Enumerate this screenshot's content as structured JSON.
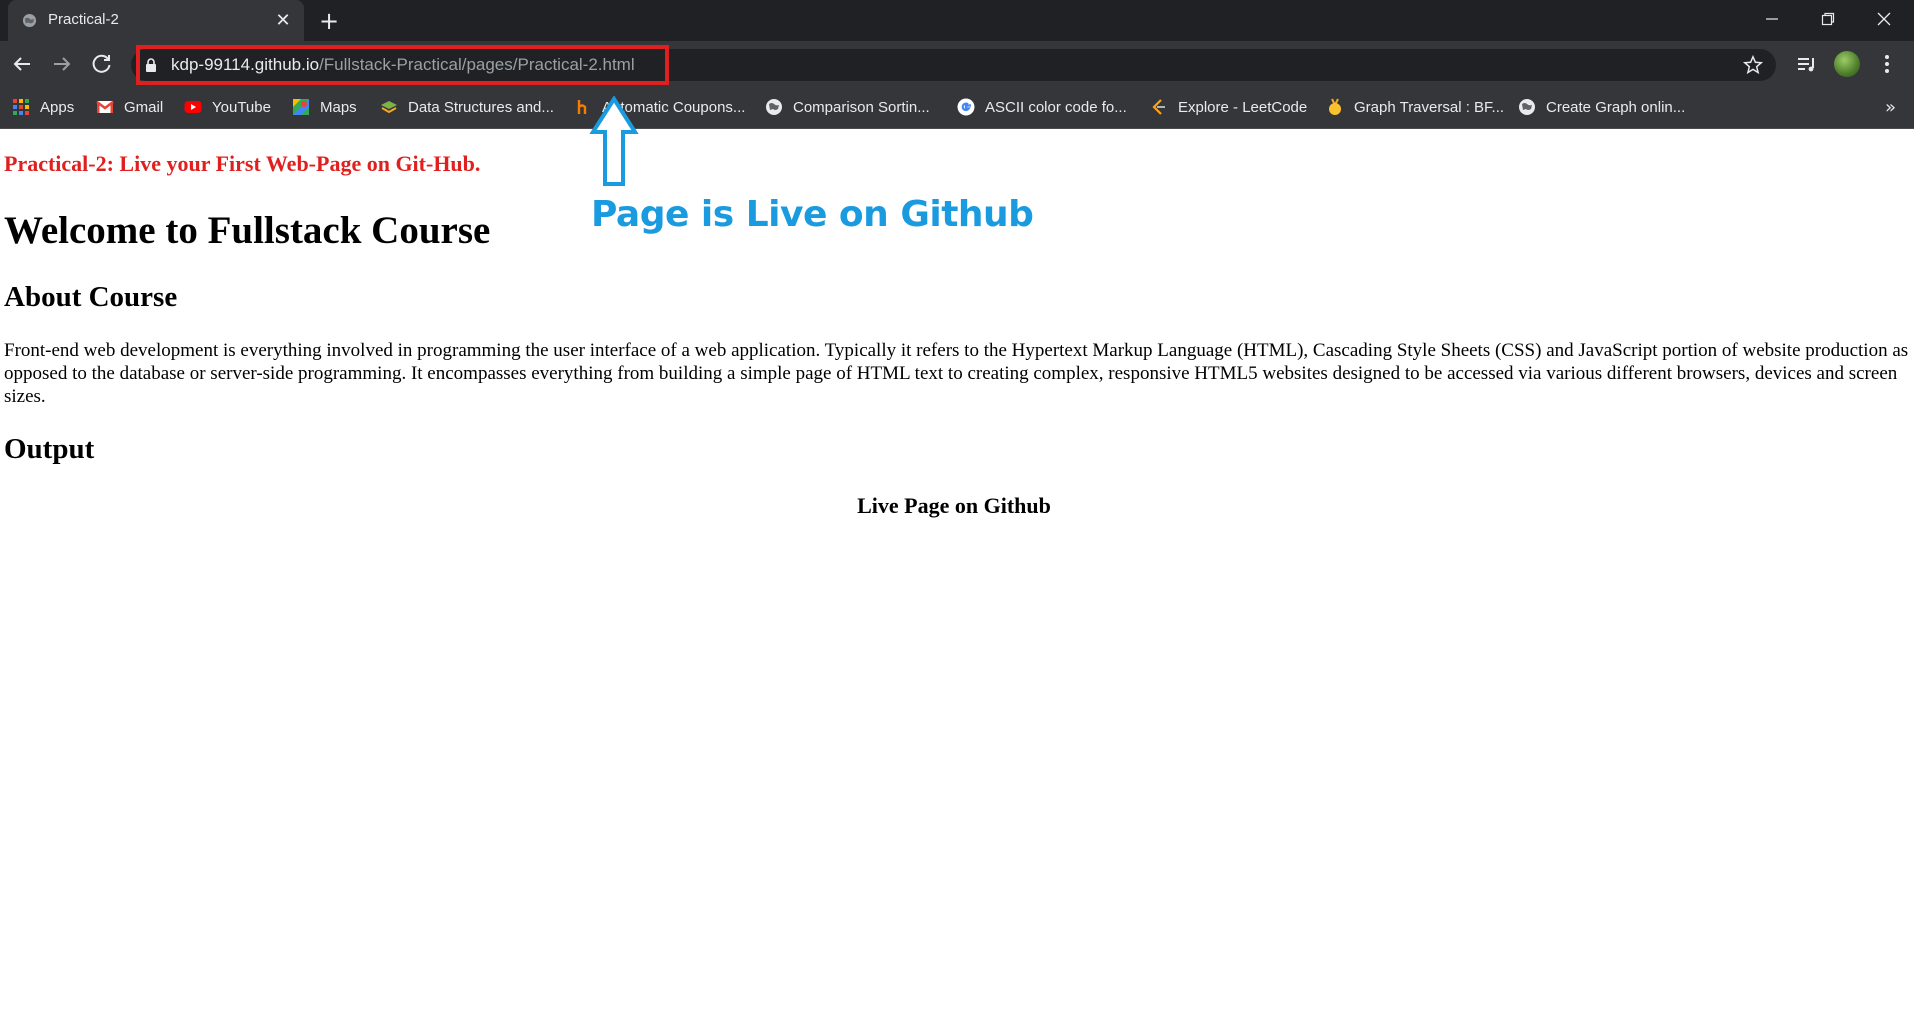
{
  "browser": {
    "tab": {
      "title": "Practical-2",
      "favicon": "globe-icon",
      "close_icon": "close-icon"
    },
    "new_tab_icon": "plus-icon",
    "window_controls": [
      "minimize-icon",
      "restore-icon",
      "close-icon"
    ],
    "url": {
      "host": "kdp-99114.github.io",
      "path": "/Fullstack-Practical/pages/Practical-2.html"
    },
    "bookmarks": [
      {
        "label": "Apps",
        "icon": "apps-grid-icon"
      },
      {
        "label": "Gmail",
        "icon": "gmail-icon"
      },
      {
        "label": "YouTube",
        "icon": "youtube-icon"
      },
      {
        "label": "Maps",
        "icon": "maps-icon"
      },
      {
        "label": "Data Structures and...",
        "icon": "layers-icon"
      },
      {
        "label": "Automatic Coupons...",
        "icon": "honey-icon"
      },
      {
        "label": "Comparison Sortin...",
        "icon": "globe-icon"
      },
      {
        "label": "ASCII color code fo...",
        "icon": "google-icon"
      },
      {
        "label": "Explore - LeetCode",
        "icon": "leetcode-icon"
      },
      {
        "label": "Graph Traversal : BF...",
        "icon": "medal-icon"
      },
      {
        "label": "Create Graph onlin...",
        "icon": "globe-icon"
      }
    ],
    "more_bookmarks": "»"
  },
  "page": {
    "practical_title": "Practical-2: Live your First Web-Page on Git-Hub.",
    "heading": "Welcome to Fullstack Course",
    "about_heading": "About Course",
    "about_text": "Front-end web development is everything involved in programming the user interface of a web application. Typically it refers to the Hypertext Markup Language (HTML), Cascading Style Sheets (CSS) and JavaScript portion of website production as opposed to the database or server-side programming. It encompasses everything from building a simple page of HTML text to creating complex, responsive HTML5 websites designed to be accessed via various different browsers, devices and screen sizes.",
    "output_heading": "Output",
    "output_caption": "Live Page on Github"
  },
  "annotation": {
    "text": "Page is Live on Github",
    "color": "#1a9be0",
    "highlight_color": "#e0201f"
  }
}
